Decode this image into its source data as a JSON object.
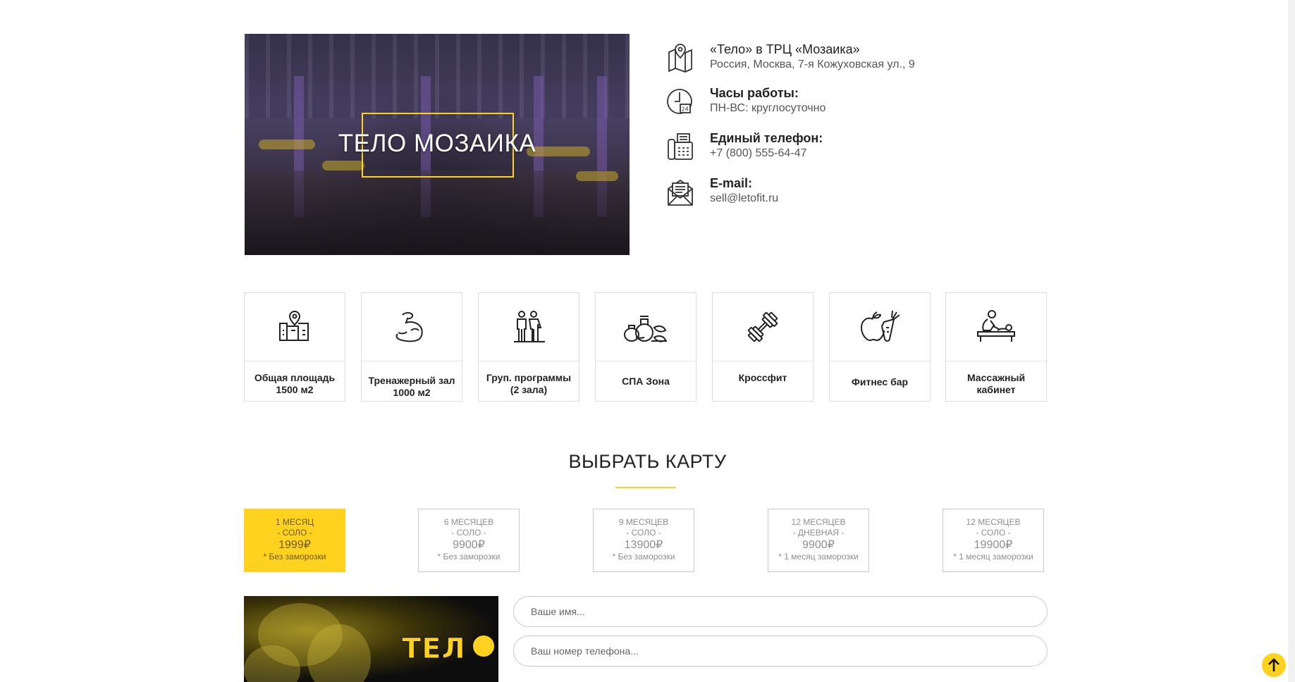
{
  "hero": {
    "title": "ТЕЛО МОЗАИКА"
  },
  "contacts": [
    {
      "icon": "map-icon",
      "title": "«Тело» в ТРЦ «Мозаика»",
      "sub": "Россия, Москва, 7-я Кожуховская ул., 9"
    },
    {
      "icon": "clock-24-icon",
      "title": "Часы работы:",
      "sub": "ПН-ВС: круглосуточно"
    },
    {
      "icon": "fax-phone-icon",
      "title": "Единый телефон:",
      "sub": "+7 (800) 555-64-47"
    },
    {
      "icon": "envelope-icon",
      "title": "E-mail:",
      "sub": "sell@letofit.ru"
    }
  ],
  "features": [
    {
      "icon": "area-map-icon",
      "label": "Общая площадь 1500 м2"
    },
    {
      "icon": "biceps-icon",
      "label": "Тренажерный зал 1000 м2"
    },
    {
      "icon": "group-people-icon",
      "label": "Груп. программы (2 зала)"
    },
    {
      "icon": "spa-bottles-icon",
      "label": "СПА Зона"
    },
    {
      "icon": "dumbbell-icon",
      "label": "Кроссфит"
    },
    {
      "icon": "apple-carrot-icon",
      "label": "Фитнес бар"
    },
    {
      "icon": "massage-icon",
      "label": "Массажный кабинет"
    }
  ],
  "choose": {
    "title": "ВЫБРАТЬ КАРТУ"
  },
  "cards": [
    {
      "l1": "1 МЕСЯЦ",
      "l2": "- СОЛО -",
      "price": "1999₽",
      "note": "* Без заморозки",
      "active": true
    },
    {
      "l1": "6 МЕСЯЦЕВ",
      "l2": "- СОЛО -",
      "price": "9900₽",
      "note": "* Без заморозки",
      "active": false
    },
    {
      "l1": "9 МЕСЯЦЕВ",
      "l2": "- СОЛО -",
      "price": "13900₽",
      "note": "* Без заморозки",
      "active": false
    },
    {
      "l1": "12 МЕСЯЦЕВ",
      "l2": "- ДНЕВНАЯ -",
      "price": "9900₽",
      "note": "* 1 месяц заморозки",
      "active": false
    },
    {
      "l1": "12 МЕСЯЦЕВ",
      "l2": "- СОЛО -",
      "price": "19900₽",
      "note": "* 1 месяц заморозки",
      "active": false
    }
  ],
  "banner": {
    "logo": "ТЕЛ"
  },
  "form": {
    "name_placeholder": "Ваше имя...",
    "phone_placeholder": "Ваш номер телефона..."
  },
  "colors": {
    "accent": "#ffd21f"
  }
}
